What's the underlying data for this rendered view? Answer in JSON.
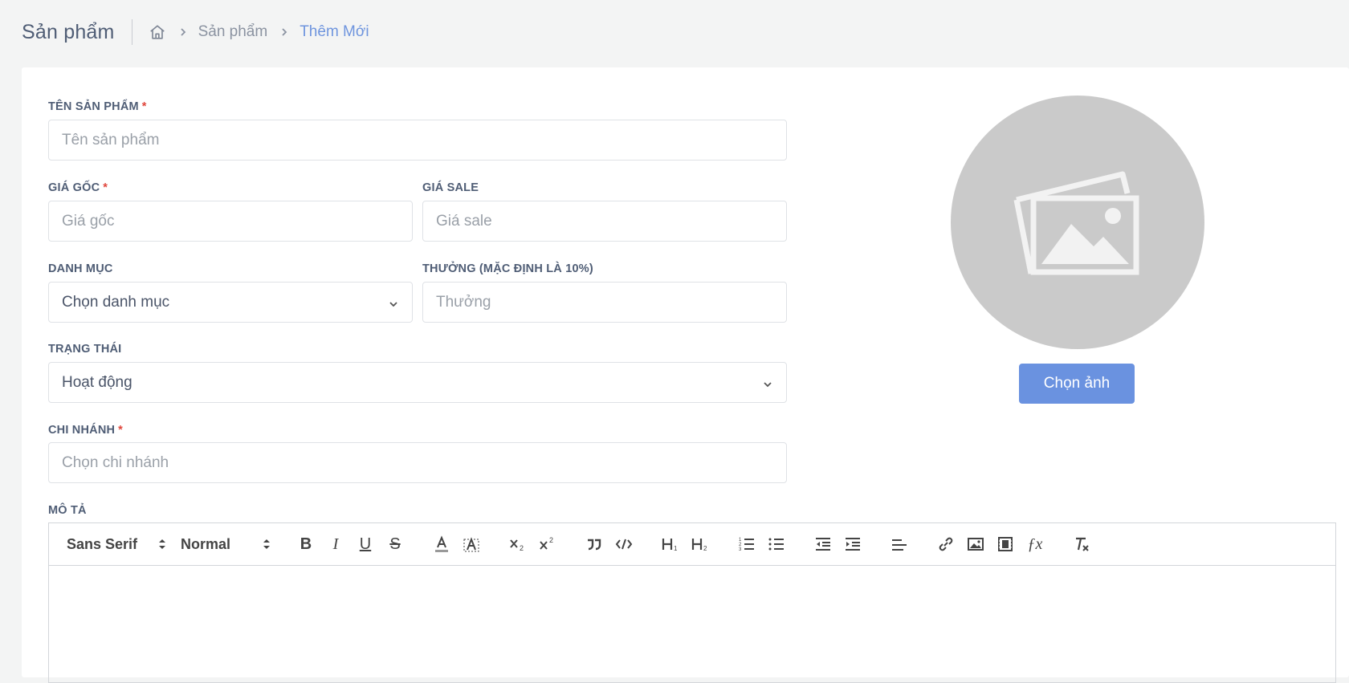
{
  "header": {
    "title": "Sản phẩm",
    "breadcrumb": [
      {
        "label": "Sản phẩm"
      },
      {
        "label": "Thêm Mới"
      }
    ]
  },
  "form": {
    "product_name": {
      "label": "TÊN SẢN PHẨM",
      "required_mark": "*",
      "placeholder": "Tên sản phẩm"
    },
    "original_price": {
      "label": "GIÁ GỐC",
      "required_mark": "*",
      "placeholder": "Giá gốc"
    },
    "sale_price": {
      "label": "GIÁ SALE",
      "placeholder": "Giá sale"
    },
    "category": {
      "label": "DANH MỤC",
      "value": "Chọn danh mục"
    },
    "bonus": {
      "label": "THƯỞNG (MẶC ĐỊNH LÀ 10%)",
      "placeholder": "Thưởng"
    },
    "status": {
      "label": "TRẠNG THÁI",
      "value": "Hoạt động"
    },
    "branch": {
      "label": "CHI NHÁNH",
      "required_mark": "*",
      "placeholder": "Chọn chi nhánh"
    },
    "description": {
      "label": "MÔ TẢ"
    }
  },
  "image": {
    "button_label": "Chọn ảnh",
    "placeholder_icon": "images-icon"
  },
  "editor": {
    "font_select": "Sans Serif",
    "size_select": "Normal",
    "buttons": [
      "bold",
      "italic",
      "underline",
      "strike",
      "color",
      "background",
      "subscript",
      "superscript",
      "blockquote",
      "code-block",
      "header-1",
      "header-2",
      "ordered-list",
      "bullet-list",
      "outdent",
      "indent",
      "align",
      "link",
      "image",
      "video",
      "formula",
      "clean"
    ]
  },
  "colors": {
    "accent": "#6a92e0",
    "breadcrumb_active": "#6f95de",
    "required": "#e0463c",
    "avatar_bg": "#cacaca"
  }
}
